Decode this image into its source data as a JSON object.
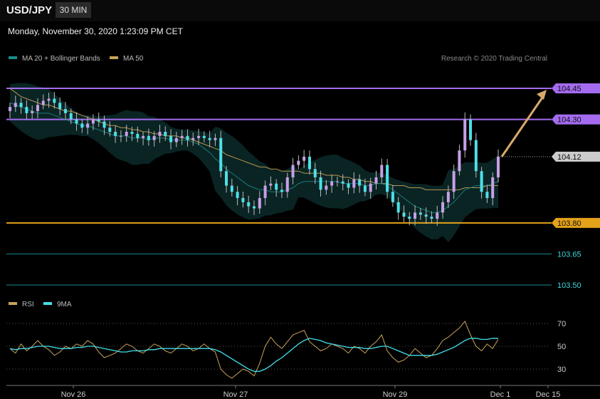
{
  "header": {
    "symbol": "USD/JPY",
    "timeframe": "30 MIN",
    "datetime": "Monday, November 30, 2020 1:23:09 PM CET"
  },
  "legend_main": [
    {
      "label": "MA 20 + Bollinger Bands",
      "color": "#1a8c8c"
    },
    {
      "label": "MA 50",
      "color": "#c9a35a"
    }
  ],
  "copyright": "Research © 2020 Trading Central",
  "legend_rsi": [
    {
      "label": "RSI",
      "color": "#c9a35a"
    },
    {
      "label": "9MA",
      "color": "#3fe0ec"
    }
  ],
  "chart_data": [
    {
      "type": "candlestick",
      "ylim": [
        103.4,
        104.55
      ],
      "x_ticks": [
        "Nov 26",
        "Nov 27",
        "Nov 29",
        "Dec 1",
        "Dec 15"
      ],
      "last_price": 104.12,
      "levels": [
        {
          "value": 104.45,
          "label": "104.45",
          "color": "#a46bf0",
          "kind": "resistance"
        },
        {
          "value": 104.3,
          "label": "104.30",
          "color": "#a46bf0",
          "kind": "resistance"
        },
        {
          "value": 104.12,
          "label": "104.12",
          "color": "#cccccc",
          "kind": "last"
        },
        {
          "value": 103.8,
          "label": "103.80",
          "color": "#e3a21a",
          "kind": "pivot"
        },
        {
          "value": 103.65,
          "label": "103.65",
          "color": "#1a8c8c",
          "kind": "support"
        },
        {
          "value": 103.5,
          "label": "103.50",
          "color": "#1a8c8c",
          "kind": "support"
        }
      ],
      "target_arrow": {
        "from": 104.12,
        "to": 104.45
      },
      "close_series": [
        104.36,
        104.38,
        104.36,
        104.33,
        104.34,
        104.37,
        104.39,
        104.4,
        104.38,
        104.35,
        104.33,
        104.3,
        104.28,
        104.26,
        104.28,
        104.3,
        104.29,
        104.26,
        104.24,
        104.22,
        104.22,
        104.24,
        104.23,
        104.21,
        104.22,
        104.2,
        104.22,
        104.24,
        104.22,
        104.19,
        104.21,
        104.22,
        104.2,
        104.21,
        104.22,
        104.21,
        104.2,
        104.21,
        104.05,
        103.98,
        103.95,
        103.92,
        103.9,
        103.88,
        103.87,
        103.92,
        103.98,
        103.99,
        103.96,
        103.95,
        104.02,
        104.08,
        104.1,
        104.12,
        104.06,
        104.02,
        103.96,
        103.98,
        104.0,
        104.0,
        103.99,
        103.97,
        104.01,
        103.98,
        103.95,
        103.99,
        104.02,
        104.08,
        103.95,
        103.9,
        103.85,
        103.83,
        103.82,
        103.85,
        103.84,
        103.83,
        103.82,
        103.85,
        103.9,
        103.95,
        104.05,
        104.15,
        104.3,
        104.2,
        104.05,
        103.95,
        103.92,
        104.02,
        104.12
      ],
      "ma20_series": [
        104.38,
        104.37,
        104.36,
        104.35,
        104.34,
        104.33,
        104.33,
        104.33,
        104.32,
        104.31,
        104.3,
        104.29,
        104.28,
        104.27,
        104.27,
        104.26,
        104.25,
        104.24,
        104.23,
        104.22,
        104.22,
        104.22,
        104.21,
        104.21,
        104.21,
        104.2,
        104.21,
        104.21,
        104.21,
        104.2,
        104.2,
        104.2,
        104.2,
        104.19,
        104.18,
        104.16,
        104.14,
        104.11,
        104.09,
        104.06,
        104.04,
        104.02,
        104.0,
        103.98,
        103.97,
        103.96,
        103.96,
        103.95,
        103.95,
        103.95,
        103.96,
        103.97,
        103.99,
        104.0,
        104.0,
        104.0,
        104.0,
        104.0,
        104.0,
        104.0,
        103.99,
        103.99,
        103.99,
        103.99,
        103.98,
        103.98,
        103.99,
        103.99,
        103.98,
        103.96,
        103.94,
        103.92,
        103.9,
        103.88,
        103.87,
        103.86,
        103.85,
        103.85,
        103.86,
        103.88,
        103.9,
        103.93,
        103.96,
        103.97,
        103.98,
        103.98,
        103.98,
        103.99,
        104.0
      ],
      "ma50_series": [
        104.45,
        104.43,
        104.41,
        104.4,
        104.39,
        104.38,
        104.37,
        104.37,
        104.36,
        104.35,
        104.34,
        104.34,
        104.33,
        104.32,
        104.31,
        104.3,
        104.29,
        104.28,
        104.27,
        104.27,
        104.26,
        104.26,
        104.25,
        104.25,
        104.24,
        104.24,
        104.23,
        104.23,
        104.22,
        104.22,
        104.22,
        104.21,
        104.21,
        104.2,
        104.19,
        104.18,
        104.17,
        104.16,
        104.15,
        104.13,
        104.12,
        104.11,
        104.1,
        104.09,
        104.08,
        104.07,
        104.07,
        104.06,
        104.06,
        104.05,
        104.05,
        104.05,
        104.05,
        104.04,
        104.04,
        104.04,
        104.04,
        104.03,
        104.03,
        104.03,
        104.02,
        104.02,
        104.01,
        104.01,
        104.0,
        104.0,
        103.99,
        103.99,
        103.99,
        103.98,
        103.98,
        103.98,
        103.97,
        103.97,
        103.97,
        103.96,
        103.96,
        103.96,
        103.96,
        103.96,
        103.96,
        103.96,
        103.97,
        103.97,
        103.97,
        103.97,
        103.98,
        103.98,
        103.98
      ]
    },
    {
      "type": "line",
      "name": "RSI",
      "ylim": [
        20,
        80
      ],
      "y_ticks": [
        70,
        50,
        30
      ],
      "series": [
        {
          "name": "RSI",
          "values": [
            48,
            44,
            52,
            46,
            50,
            55,
            50,
            47,
            42,
            45,
            50,
            48,
            52,
            50,
            55,
            52,
            45,
            40,
            42,
            44,
            48,
            52,
            50,
            46,
            44,
            48,
            52,
            50,
            46,
            44,
            48,
            52,
            50,
            46,
            48,
            52,
            48,
            45,
            30,
            25,
            22,
            26,
            30,
            28,
            24,
            35,
            50,
            58,
            52,
            48,
            54,
            60,
            62,
            64,
            54,
            50,
            46,
            48,
            52,
            50,
            48,
            44,
            50,
            48,
            44,
            50,
            54,
            60,
            46,
            40,
            36,
            38,
            42,
            48,
            44,
            40,
            42,
            48,
            55,
            58,
            62,
            66,
            72,
            60,
            50,
            46,
            52,
            48,
            56
          ]
        },
        {
          "name": "9MA",
          "values": [
            48,
            47,
            48,
            48,
            49,
            50,
            50,
            50,
            49,
            48,
            48,
            48,
            49,
            49,
            50,
            50,
            49,
            48,
            47,
            46,
            45,
            45,
            46,
            46,
            46,
            47,
            47,
            48,
            48,
            48,
            48,
            48,
            48,
            48,
            48,
            48,
            48,
            47,
            45,
            42,
            39,
            36,
            33,
            30,
            28,
            28,
            30,
            33,
            37,
            40,
            44,
            48,
            52,
            55,
            57,
            56,
            55,
            53,
            52,
            51,
            50,
            49,
            49,
            49,
            48,
            48,
            49,
            50,
            50,
            48,
            46,
            44,
            42,
            42,
            42,
            42,
            42,
            43,
            45,
            47,
            49,
            52,
            55,
            57,
            57,
            56,
            56,
            57,
            57
          ]
        }
      ]
    }
  ]
}
